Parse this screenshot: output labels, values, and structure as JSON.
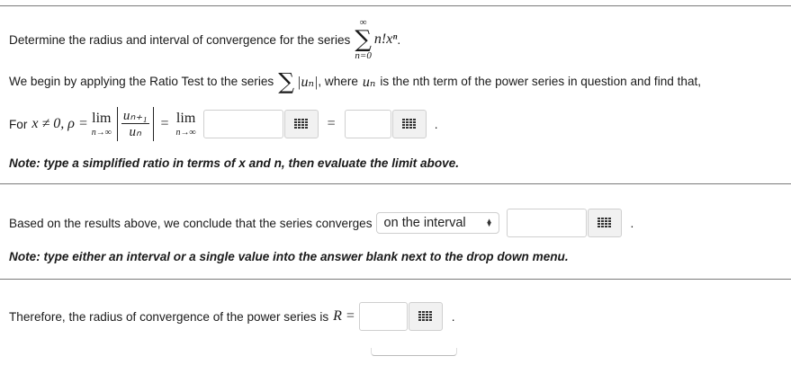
{
  "question": {
    "intro": "Determine the radius and interval of convergence for the series",
    "series_upper": "∞",
    "series_lower": "n=0",
    "series_term": "n!xⁿ",
    "series_end": "."
  },
  "ratio_test": {
    "text_start": "We begin by applying the Ratio Test to the series",
    "abs_term": "|uₙ|",
    "text_where": ", where",
    "u_n": "uₙ",
    "text_rest": "is the nth term of the power series in question and find that,",
    "condition_prefix": "For",
    "condition": "x ≠ 0, ρ =",
    "lim_word": "lim",
    "lim_sub": "n→∞",
    "frac_num": "uₙ₊₁",
    "frac_den": "uₙ",
    "equals": "=",
    "period": "."
  },
  "note1": "Note: type a simplified ratio in terms of x and n, then evaluate the limit above.",
  "conclusion": {
    "text": "Based on the results above, we conclude that the series converges",
    "dropdown_selected": "on the interval",
    "period": "."
  },
  "note2": "Note: type either an interval or a single value into the answer blank next to the drop down menu.",
  "radius": {
    "text": "Therefore, the radius of convergence of the power series is",
    "symbol": "R =",
    "period": "."
  },
  "icons": {
    "keypad": "keypad-grid-icon",
    "dropdown_arrows": "up-down-arrows-icon"
  },
  "colors": {
    "border": "#cfcfcf",
    "button_bg": "#f1f1f1",
    "rule": "#7a7a7a"
  }
}
